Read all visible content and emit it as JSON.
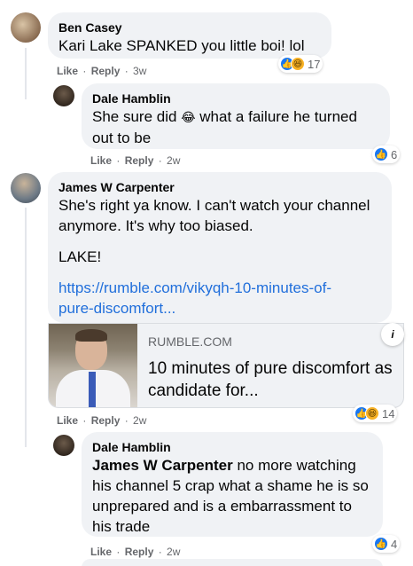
{
  "comments": [
    {
      "author": "Ben Casey",
      "text": "Kari Lake SPANKED you little boi! lol",
      "like_label": "Like",
      "reply_label": "Reply",
      "time": "3w",
      "reactions": {
        "icons": [
          "like-icon",
          "haha-icon"
        ],
        "count": "17"
      }
    },
    {
      "author": "Dale Hamblin",
      "text_before": "She sure did",
      "emoji": "😂",
      "text_after": "what a failure he turned out to be",
      "like_label": "Like",
      "reply_label": "Reply",
      "time": "2w",
      "reactions": {
        "icons": [
          "like-icon"
        ],
        "count": "6"
      }
    },
    {
      "author": "James W Carpenter",
      "text": "She's right ya know. I can't watch your channel anymore. It's why too biased.",
      "text2": "LAKE!",
      "link": "https://rumble.com/vikyqh-10-minutes-of-pure-discomfort...",
      "link_line1": "https://rumble.com/vikyqh-10-minutes-of-",
      "link_line2": "pure-discomfort...",
      "card": {
        "domain": "RUMBLE.COM",
        "title": "10 minutes of pure discomfort as candidate for...",
        "info_glyph": "i"
      },
      "like_label": "Like",
      "reply_label": "Reply",
      "time": "2w",
      "reactions": {
        "icons": [
          "like-icon",
          "haha-icon"
        ],
        "count": "14"
      }
    },
    {
      "author": "Dale Hamblin",
      "mention": "James W Carpenter",
      "text": "no more watching his channel 5 crap what a shame he is so unprepared and is a embarrassment to his trade",
      "like_label": "Like",
      "reply_label": "Reply",
      "time": "2w",
      "reactions": {
        "icons": [
          "like-icon"
        ],
        "count": "4"
      }
    }
  ],
  "colors": {
    "link": "#216fdb",
    "bubble": "#f0f2f5",
    "like": "#1877f2",
    "haha": "#f7b125",
    "meta": "#65676b"
  }
}
